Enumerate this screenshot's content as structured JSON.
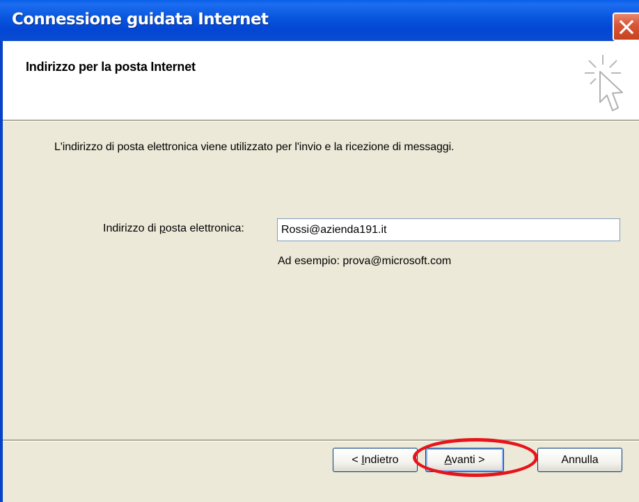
{
  "window": {
    "title": "Connessione guidata Internet"
  },
  "header": {
    "title": "Indirizzo per la posta Internet",
    "icon": "wizard-cursor-icon"
  },
  "body": {
    "description": "L'indirizzo di posta elettronica viene utilizzato per l'invio e la ricezione di messaggi.",
    "email_label_before": "Indirizzo di ",
    "email_label_accel": "p",
    "email_label_after": "osta elettronica:",
    "email_value": "Rossi@azienda191.it",
    "example": "Ad esempio: prova@microsoft.com"
  },
  "buttons": {
    "back_prefix": "< ",
    "back_accel": "I",
    "back_rest": "ndietro",
    "next_accel": "A",
    "next_rest": "vanti >",
    "cancel": "Annulla"
  },
  "annotation": {
    "highlight_color": "#e8141b",
    "highlight_target": "next-button"
  },
  "colors": {
    "titlebar": "#0855dd",
    "dialog_bg": "#ece9d8",
    "close_button": "#d9573a"
  }
}
